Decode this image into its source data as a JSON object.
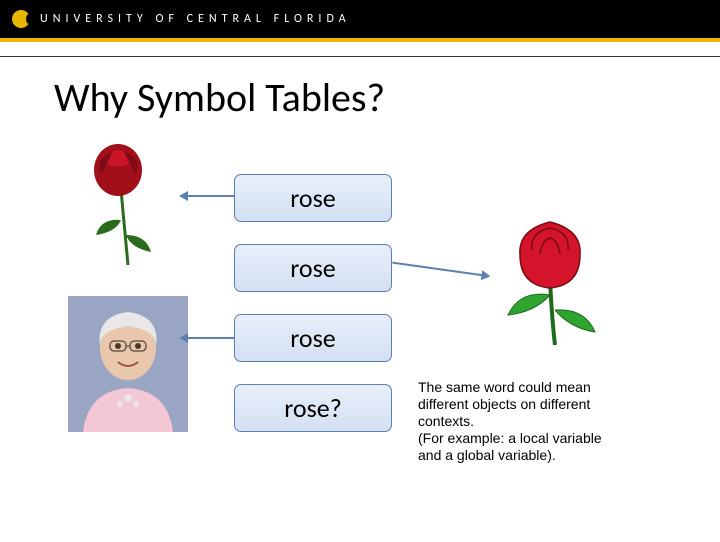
{
  "header": {
    "university": "UNIVERSITY OF CENTRAL FLORIDA"
  },
  "title": "Why Symbol Tables?",
  "labels": {
    "l1": "rose",
    "l2": "rose",
    "l3": "rose",
    "l4": "rose?"
  },
  "images": {
    "photo1_alt": "photograph of a red rose on a stem",
    "clip_alt": "clip-art red rose with leaves",
    "photo2_alt": "photograph of an elderly woman named Rose"
  },
  "caption": "The same word could mean\ndifferent objects on different\ncontexts.\n(For example: a local variable\nand a global variable)."
}
